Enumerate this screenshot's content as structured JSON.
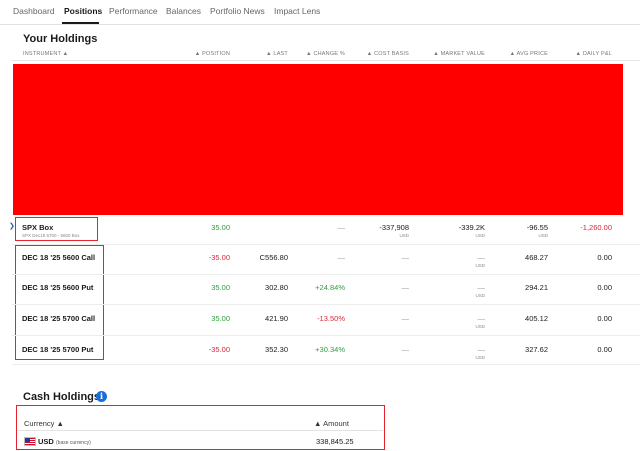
{
  "tabs": [
    {
      "label": "Dashboard",
      "active": false
    },
    {
      "label": "Positions",
      "active": true
    },
    {
      "label": "Performance",
      "active": false
    },
    {
      "label": "Balances",
      "active": false
    },
    {
      "label": "Portfolio News",
      "active": false
    },
    {
      "label": "Impact Lens",
      "active": false
    }
  ],
  "holdings": {
    "title": "Your Holdings",
    "columns": {
      "instrument": "INSTRUMENT ▲",
      "position": "▲ POSITION",
      "last": "▲ LAST",
      "change_pct": "▲ CHANGE %",
      "cost_basis": "▲ COST BASIS",
      "market_value": "▲ MARKET VALUE",
      "avg_price": "▲ AVG PRICE",
      "daily_pl": "▲ DAILY P&L"
    },
    "group": {
      "name": "SPX Box",
      "description": "SPX Dec18 5700 - 5600 Box",
      "position": "35.00",
      "last": "—",
      "change_pct": "—",
      "cost_basis": "-337,908",
      "cost_basis_currency": "USD",
      "market_value": "-339.2K",
      "market_value_currency": "USD",
      "avg_price": "-96.55",
      "avg_price_currency": "USD",
      "daily_pl": "-1,260.00"
    },
    "rows": [
      {
        "name": "DEC 18 '25 5600 Call",
        "position": "-35.00",
        "position_color": "red",
        "last": "C556.80",
        "change_pct": "—",
        "change_color": "dash",
        "cost_basis": "—",
        "market_value": "—",
        "market_value_currency": "USD",
        "avg_price": "468.27",
        "daily_pl": "0.00"
      },
      {
        "name": "DEC 18 '25 5600 Put",
        "position": "35.00",
        "position_color": "green",
        "last": "302.80",
        "change_pct": "+24.84%",
        "change_color": "green",
        "cost_basis": "—",
        "market_value": "—",
        "market_value_currency": "USD",
        "avg_price": "294.21",
        "daily_pl": "0.00"
      },
      {
        "name": "DEC 18 '25 5700 Call",
        "position": "35.00",
        "position_color": "green",
        "last": "421.90",
        "change_pct": "-13.50%",
        "change_color": "red",
        "cost_basis": "—",
        "market_value": "—",
        "market_value_currency": "USD",
        "avg_price": "405.12",
        "daily_pl": "0.00"
      },
      {
        "name": "DEC 18 '25 5700 Put",
        "position": "-35.00",
        "position_color": "red",
        "last": "352.30",
        "change_pct": "+30.34%",
        "change_color": "green",
        "cost_basis": "—",
        "market_value": "—",
        "market_value_currency": "USD",
        "avg_price": "327.62",
        "daily_pl": "0.00"
      }
    ]
  },
  "cash": {
    "title": "Cash Holdings",
    "info_glyph": "i",
    "currency_header": "Currency ▲",
    "amount_header": "▲ Amount",
    "currency": "USD",
    "currency_note": "(base currency)",
    "amount": "338,845.25"
  },
  "colors": {
    "green": "#2e9e3e",
    "red": "#d8283a",
    "redaction": "#ff0000",
    "annotation_box": "#e5242d",
    "info": "#1a6ed8"
  }
}
